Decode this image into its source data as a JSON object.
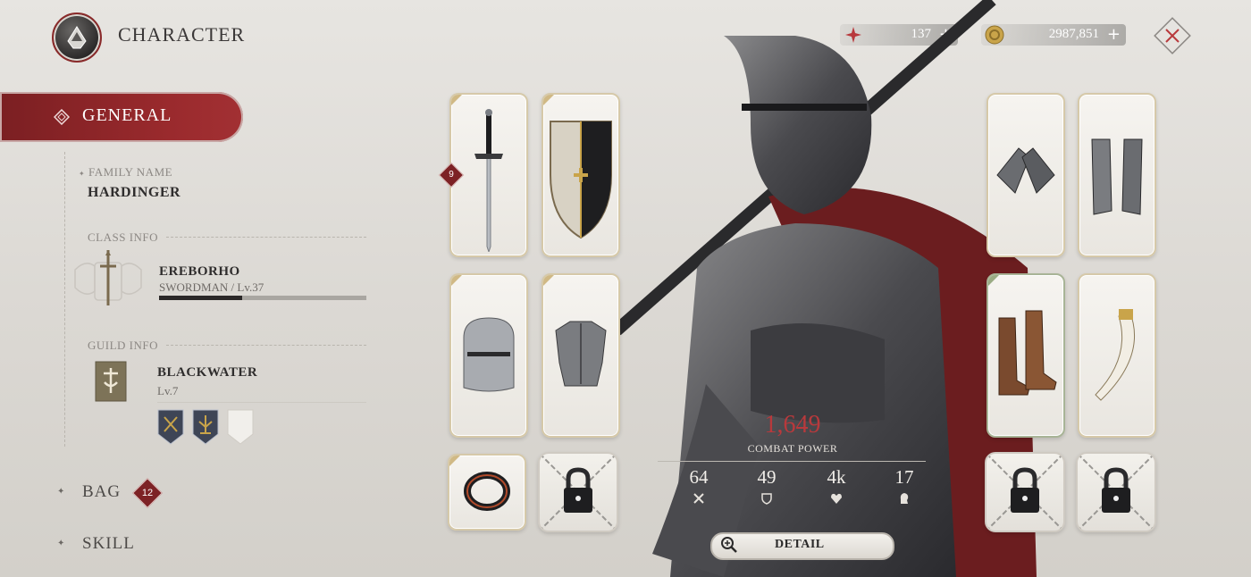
{
  "header": {
    "title": "CHARACTER",
    "currencies": [
      {
        "name": "crystal",
        "icon": "red-star-icon",
        "value": "137",
        "plus": "+"
      },
      {
        "name": "gold",
        "icon": "gold-coin-icon",
        "value": "2987,851",
        "plus": "+"
      }
    ]
  },
  "sidebar": {
    "active_tab": "GENERAL",
    "family": {
      "label": "FAMILY NAME",
      "value": "HARDINGER"
    },
    "class": {
      "label": "CLASS INFO",
      "name": "EREBORHO",
      "detail": "SWORDMAN / Lv.37",
      "progress_pct": 40
    },
    "guild": {
      "label": "GUILD INFO",
      "name": "BLACKWATER",
      "level": "Lv.7"
    },
    "menu": [
      {
        "label": "BAG",
        "badge": "12"
      },
      {
        "label": "SKILL"
      }
    ]
  },
  "equipment": {
    "weapon_level": "9",
    "left_slots": [
      "sword",
      "shield",
      "helmet",
      "chest-armor",
      "ring",
      "locked"
    ],
    "right_slots": [
      "gauntlets",
      "greaves",
      "boots",
      "horn",
      "locked",
      "locked"
    ]
  },
  "combat": {
    "value": "1,649",
    "label": "COMBAT POWER",
    "stats": [
      {
        "name": "attack",
        "value": "64",
        "icon": "crossed-swords-icon"
      },
      {
        "name": "defense",
        "value": "49",
        "icon": "shield-icon"
      },
      {
        "name": "health",
        "value": "4k",
        "icon": "heart-icon"
      },
      {
        "name": "mind",
        "value": "17",
        "icon": "head-icon"
      }
    ]
  },
  "detail_button": {
    "label": "DETAIL"
  },
  "colors": {
    "accent": "#9a2a2d",
    "power": "#b8393c",
    "gold": "#c9a44a"
  }
}
